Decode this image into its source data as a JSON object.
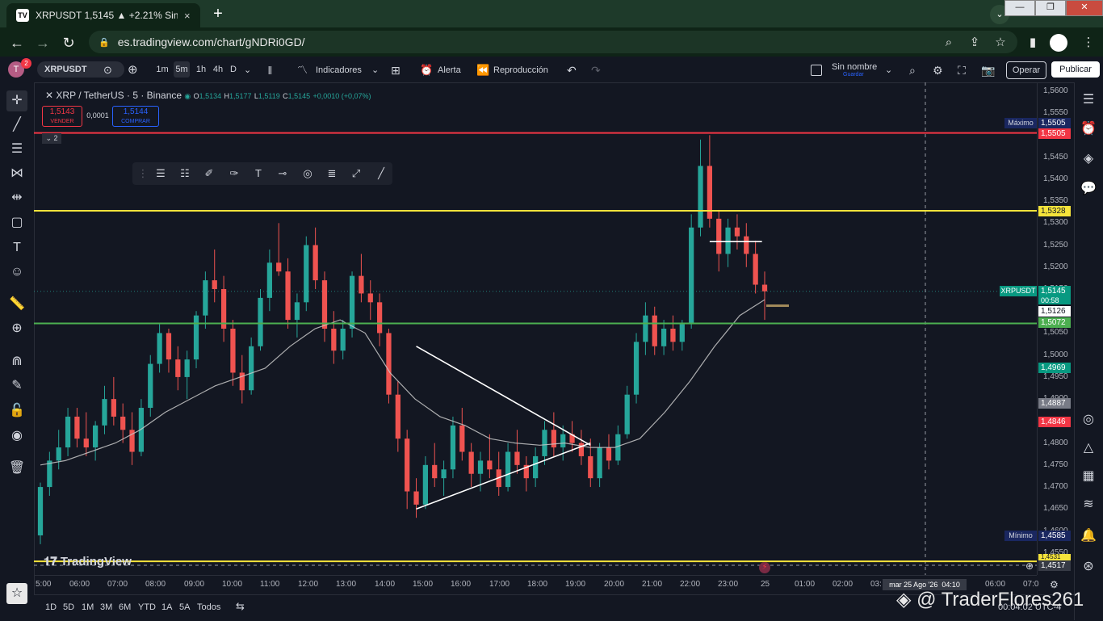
{
  "browser": {
    "tab_title": "XRPUSDT 1,5145 ▲ +2.21% Sin n",
    "favicon_text": "TV",
    "url": "es.tradingview.com/chart/gNDRi0GD/",
    "new_tab": "+",
    "close_tab": "×"
  },
  "toolbar": {
    "avatar": "T",
    "badge": "2",
    "symbol": "XRPUSDT",
    "timeframes": [
      "1m",
      "5m",
      "1h",
      "4h",
      "D"
    ],
    "active_timeframe": "5m",
    "indicators": "Indicadores",
    "alert": "Alerta",
    "replay": "Reproducción",
    "layout_name": "Sin nombre",
    "layout_save": "Guardar",
    "trade": "Operar",
    "publish": "Publicar"
  },
  "legend": {
    "symbol": "XRP / TetherUS · 5 · Binance",
    "o_key": "O",
    "o": "1,5134",
    "h_key": "H",
    "h": "1,5177",
    "l_key": "L",
    "l": "1,5119",
    "c_key": "C",
    "c": "1,5145",
    "change": "+0,0010 (+0,07%)"
  },
  "trade_widget": {
    "sell_price": "1,5143",
    "sell_label": "VENDER",
    "spread": "0,0001",
    "buy_price": "1,5144",
    "buy_label": "COMPRAR",
    "collapse": "2"
  },
  "price_axis": {
    "ticks": [
      "1,5600",
      "1,5550",
      "1,5450",
      "1,5400",
      "1,5350",
      "1,5300",
      "1,5250",
      "1,5200",
      "1,5150",
      "1,5100",
      "1,5050",
      "1,5000",
      "1,4950",
      "1,4900",
      "1,4850",
      "1,4800",
      "1,4750",
      "1,4700",
      "1,4650",
      "1,4600",
      "1,4550"
    ],
    "max_label": "Máximo",
    "max_value": "1,5505",
    "level_red": "1,5505",
    "level_yellow": "1,5328",
    "symbol_tag": "XRPUSDT",
    "last_price": "1,5145",
    "countdown": "00:58",
    "ma_value": "1,5126",
    "level_green": "1,5072",
    "green_tag": "1,4969",
    "gray_tag": "1,4887",
    "red_tag": "1,4846",
    "min_label": "Mínimo",
    "min_value": "1,4585",
    "yellow_bottom": "1,4531",
    "cursor_price": "1,4517"
  },
  "time_axis": {
    "ticks": [
      "5:00",
      "06:00",
      "07:00",
      "08:00",
      "09:00",
      "10:00",
      "11:00",
      "12:00",
      "13:00",
      "14:00",
      "15:00",
      "16:00",
      "17:00",
      "18:00",
      "19:00",
      "20:00",
      "21:00",
      "22:00",
      "23:00",
      "25",
      "01:00",
      "02:00",
      "03:",
      "04:10",
      "06:00",
      "07:0"
    ],
    "cursor_time": "mar 25 Ago '26"
  },
  "bottom": {
    "ranges": [
      "1D",
      "5D",
      "1M",
      "3M",
      "6M",
      "YTD",
      "1A",
      "5A",
      "Todos"
    ],
    "clock": "00:04:02 UTC-4",
    "watermark": "@ TraderFlores261",
    "logo": "TradingView"
  },
  "colors": {
    "background": "#131722",
    "up": "#26a69a",
    "down": "#ef5350",
    "red_line": "#f23645",
    "yellow_line": "#f5e33b",
    "green_line": "#4caf50",
    "ma_line": "#c8c8c8"
  },
  "chart_data": {
    "type": "candlestick",
    "symbol": "XRP / TetherUS",
    "interval": "5",
    "ylim": [
      1.45,
      1.562
    ],
    "price_levels": [
      1.5505,
      1.5328,
      1.5072,
      1.4531
    ],
    "x_ticks": [
      "5:00",
      "06:00",
      "07:00",
      "08:00",
      "09:00",
      "10:00",
      "11:00",
      "12:00",
      "13:00",
      "14:00",
      "15:00",
      "16:00",
      "17:00",
      "18:00",
      "19:00",
      "20:00",
      "21:00",
      "22:00",
      "23:00",
      "25"
    ],
    "moving_average": [
      1.475,
      1.476,
      1.478,
      1.48,
      1.483,
      1.487,
      1.49,
      1.493,
      1.495,
      1.497,
      1.502,
      1.506,
      1.508,
      1.505,
      1.496,
      1.49,
      1.486,
      1.484,
      1.481,
      1.48,
      1.4795,
      1.48,
      1.479,
      1.479,
      1.481,
      1.487,
      1.494,
      1.502,
      1.509,
      1.5126
    ],
    "candles": [
      [
        1.459,
        1.471,
        1.457,
        1.47
      ],
      [
        1.47,
        1.478,
        1.468,
        1.476
      ],
      [
        1.476,
        1.483,
        1.474,
        1.479
      ],
      [
        1.479,
        1.488,
        1.477,
        1.486
      ],
      [
        1.486,
        1.488,
        1.479,
        1.481
      ],
      [
        1.481,
        1.487,
        1.477,
        1.479
      ],
      [
        1.479,
        1.485,
        1.476,
        1.484
      ],
      [
        1.484,
        1.493,
        1.482,
        1.49
      ],
      [
        1.49,
        1.495,
        1.484,
        1.486
      ],
      [
        1.486,
        1.489,
        1.48,
        1.483
      ],
      [
        1.483,
        1.487,
        1.475,
        1.478
      ],
      [
        1.478,
        1.49,
        1.477,
        1.488
      ],
      [
        1.488,
        1.5,
        1.486,
        1.498
      ],
      [
        1.498,
        1.507,
        1.496,
        1.505
      ],
      [
        1.505,
        1.506,
        1.496,
        1.499
      ],
      [
        1.499,
        1.502,
        1.492,
        1.495
      ],
      [
        1.495,
        1.501,
        1.49,
        1.499
      ],
      [
        1.499,
        1.51,
        1.497,
        1.509
      ],
      [
        1.509,
        1.519,
        1.506,
        1.517
      ],
      [
        1.517,
        1.524,
        1.512,
        1.515
      ],
      [
        1.515,
        1.518,
        1.503,
        1.506
      ],
      [
        1.506,
        1.508,
        1.493,
        1.496
      ],
      [
        1.496,
        1.5,
        1.489,
        1.492
      ],
      [
        1.492,
        1.504,
        1.491,
        1.502
      ],
      [
        1.502,
        1.515,
        1.501,
        1.513
      ],
      [
        1.513,
        1.524,
        1.51,
        1.521
      ],
      [
        1.521,
        1.53,
        1.518,
        1.519
      ],
      [
        1.519,
        1.522,
        1.506,
        1.508
      ],
      [
        1.508,
        1.514,
        1.504,
        1.512
      ],
      [
        1.512,
        1.527,
        1.51,
        1.525
      ],
      [
        1.525,
        1.529,
        1.515,
        1.517
      ],
      [
        1.517,
        1.519,
        1.503,
        1.506
      ],
      [
        1.506,
        1.51,
        1.498,
        1.501
      ],
      [
        1.501,
        1.508,
        1.499,
        1.506
      ],
      [
        1.506,
        1.519,
        1.504,
        1.518
      ],
      [
        1.518,
        1.523,
        1.512,
        1.514
      ],
      [
        1.514,
        1.517,
        1.508,
        1.512
      ],
      [
        1.512,
        1.514,
        1.502,
        1.505
      ],
      [
        1.505,
        1.506,
        1.489,
        1.491
      ],
      [
        1.491,
        1.494,
        1.478,
        1.481
      ],
      [
        1.481,
        1.483,
        1.465,
        1.469
      ],
      [
        1.469,
        1.472,
        1.463,
        1.466
      ],
      [
        1.466,
        1.477,
        1.465,
        1.475
      ],
      [
        1.475,
        1.48,
        1.47,
        1.472
      ],
      [
        1.472,
        1.476,
        1.468,
        1.474
      ],
      [
        1.474,
        1.486,
        1.472,
        1.484
      ],
      [
        1.484,
        1.488,
        1.476,
        1.478
      ],
      [
        1.478,
        1.48,
        1.47,
        1.473
      ],
      [
        1.473,
        1.478,
        1.469,
        1.476
      ],
      [
        1.476,
        1.482,
        1.472,
        1.474
      ],
      [
        1.474,
        1.478,
        1.468,
        1.47
      ],
      [
        1.47,
        1.48,
        1.469,
        1.478
      ],
      [
        1.478,
        1.483,
        1.473,
        1.475
      ],
      [
        1.475,
        1.477,
        1.469,
        1.472
      ],
      [
        1.472,
        1.479,
        1.47,
        1.477
      ],
      [
        1.477,
        1.485,
        1.475,
        1.483
      ],
      [
        1.483,
        1.487,
        1.477,
        1.479
      ],
      [
        1.479,
        1.484,
        1.476,
        1.482
      ],
      [
        1.482,
        1.485,
        1.478,
        1.48
      ],
      [
        1.48,
        1.483,
        1.475,
        1.477
      ],
      [
        1.477,
        1.481,
        1.47,
        1.472
      ],
      [
        1.472,
        1.48,
        1.47,
        1.479
      ],
      [
        1.479,
        1.482,
        1.474,
        1.476
      ],
      [
        1.476,
        1.484,
        1.475,
        1.482
      ],
      [
        1.482,
        1.493,
        1.481,
        1.491
      ],
      [
        1.491,
        1.505,
        1.489,
        1.503
      ],
      [
        1.503,
        1.512,
        1.5,
        1.509
      ],
      [
        1.509,
        1.511,
        1.5,
        1.502
      ],
      [
        1.502,
        1.508,
        1.5,
        1.506
      ],
      [
        1.506,
        1.509,
        1.501,
        1.503
      ],
      [
        1.503,
        1.508,
        1.501,
        1.507
      ],
      [
        1.507,
        1.532,
        1.506,
        1.529
      ],
      [
        1.529,
        1.549,
        1.527,
        1.543
      ],
      [
        1.543,
        1.55,
        1.529,
        1.531
      ],
      [
        1.531,
        1.533,
        1.519,
        1.523
      ],
      [
        1.523,
        1.531,
        1.52,
        1.529
      ],
      [
        1.529,
        1.532,
        1.524,
        1.527
      ],
      [
        1.527,
        1.53,
        1.52,
        1.523
      ],
      [
        1.523,
        1.526,
        1.514,
        1.516
      ],
      [
        1.516,
        1.519,
        1.508,
        1.5145
      ]
    ]
  }
}
